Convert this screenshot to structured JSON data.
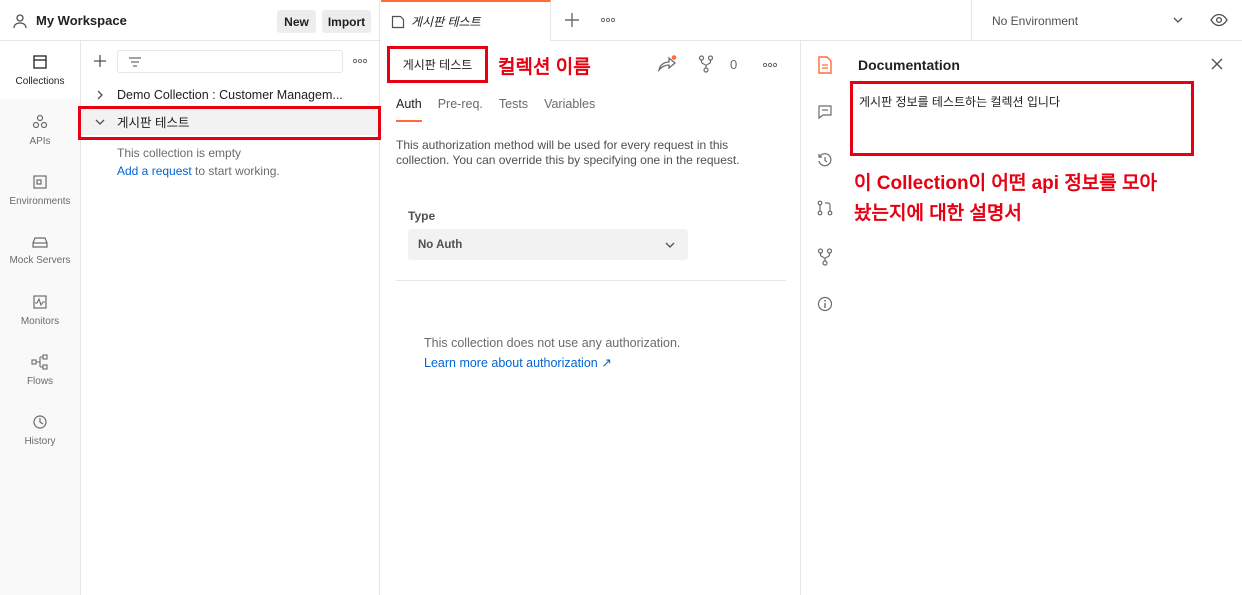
{
  "workspace": {
    "title": "My Workspace",
    "new_label": "New",
    "import_label": "Import"
  },
  "tabs_bar": {
    "active_tab_label": "게시판 테스트"
  },
  "environment": {
    "selected": "No Environment"
  },
  "rail": {
    "items": [
      {
        "label": "Collections",
        "icon": "collections-icon"
      },
      {
        "label": "APIs",
        "icon": "apis-icon"
      },
      {
        "label": "Environments",
        "icon": "environments-icon"
      },
      {
        "label": "Mock Servers",
        "icon": "mock-servers-icon"
      },
      {
        "label": "Monitors",
        "icon": "monitors-icon"
      },
      {
        "label": "Flows",
        "icon": "flows-icon"
      },
      {
        "label": "History",
        "icon": "history-icon"
      }
    ]
  },
  "sidebar": {
    "collections": [
      {
        "name": "Demo Collection : Customer Managem...",
        "expanded": false
      },
      {
        "name": "게시판 테스트",
        "expanded": true
      }
    ],
    "empty_text": "This collection is empty",
    "add_request_link": "Add a request",
    "add_request_suffix": " to start working."
  },
  "main": {
    "collection_title": "게시판 테스트",
    "annotation_name": "컬렉션 이름",
    "fork_count": "0",
    "tabs": [
      {
        "label": "Auth",
        "active": true
      },
      {
        "label": "Pre-req.",
        "active": false
      },
      {
        "label": "Tests",
        "active": false
      },
      {
        "label": "Variables",
        "active": false
      }
    ],
    "auth_description": "This authorization method will be used for every request in this collection. You can override this by specifying one in the request.",
    "type_label": "Type",
    "type_value": "No Auth",
    "no_auth_text": "This collection does not use any authorization.",
    "learn_more_link": "Learn more about authorization ↗"
  },
  "documentation": {
    "title": "Documentation",
    "description": "게시판 정보를 테스트하는 컬렉션 입니다",
    "annotation_line1": "이 Collection이 어떤 api 정보를 모아",
    "annotation_line2": "놨는지에 대한 설명서"
  },
  "colors": {
    "accent": "#ff6c37",
    "annotation": "#e60012",
    "link": "#0265d2"
  }
}
